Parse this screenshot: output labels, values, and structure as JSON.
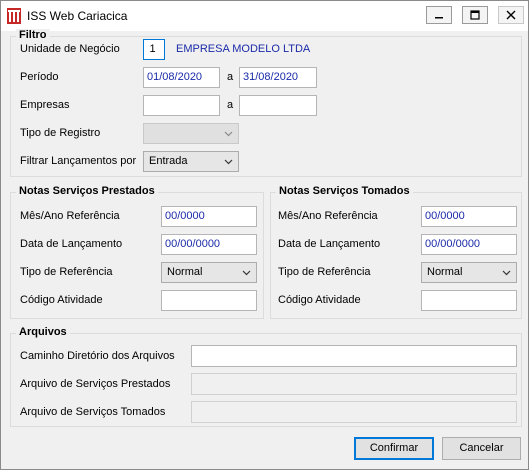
{
  "window": {
    "title": "ISS Web Cariacica"
  },
  "filtro": {
    "title": "Filtro",
    "unidade_label": "Unidade de Negócio",
    "unidade_code": "1",
    "unidade_name": "EMPRESA MODELO LTDA",
    "periodo_label": "Período",
    "periodo_start": "01/08/2020",
    "periodo_sep": "a",
    "periodo_end": "31/08/2020",
    "empresas_label": "Empresas",
    "empresas_sep": "a",
    "empresas_start": "",
    "empresas_end": "",
    "tipo_registro_label": "Tipo de Registro",
    "tipo_registro_value": "",
    "filtrar_label": "Filtrar Lançamentos por",
    "filtrar_value": "Entrada"
  },
  "prestados": {
    "title": "Notas Serviços Prestados",
    "mes_ano_label": "Mês/Ano Referência",
    "mes_ano_value": "00/0000",
    "data_label": "Data de Lançamento",
    "data_value": "00/00/0000",
    "tipo_label": "Tipo de Referência",
    "tipo_value": "Normal",
    "codigo_label": "Código Atividade",
    "codigo_value": ""
  },
  "tomados": {
    "title": "Notas Serviços Tomados",
    "mes_ano_label": "Mês/Ano Referência",
    "mes_ano_value": "00/0000",
    "data_label": "Data de Lançamento",
    "data_value": "00/00/0000",
    "tipo_label": "Tipo de Referência",
    "tipo_value": "Normal",
    "codigo_label": "Código Atividade",
    "codigo_value": ""
  },
  "arquivos": {
    "title": "Arquivos",
    "caminho_label": "Caminho Diretório dos Arquivos",
    "caminho_value": "",
    "prestados_label": "Arquivo de Serviços Prestados",
    "prestados_value": "",
    "tomados_label": "Arquivo de Serviços Tomados",
    "tomados_value": ""
  },
  "buttons": {
    "confirmar": "Confirmar",
    "cancelar": "Cancelar"
  },
  "colors": {
    "input_text": "#1a2aa8",
    "default_border": "#0078d7",
    "app_icon": "#c62828"
  }
}
